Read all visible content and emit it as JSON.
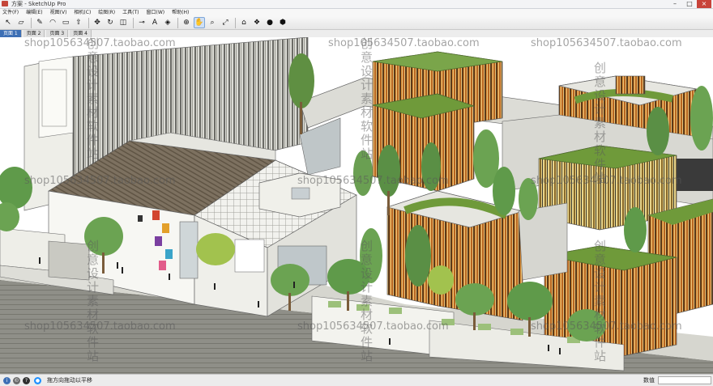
{
  "window": {
    "title": "方案 - SketchUp Pro",
    "controls": [
      "–",
      "□",
      "×"
    ]
  },
  "menu": {
    "items": [
      "文件(F)",
      "编辑(E)",
      "视图(V)",
      "相机(C)",
      "绘图(R)",
      "工具(T)",
      "窗口(W)",
      "帮助(H)"
    ]
  },
  "toolbar": {
    "tools": [
      {
        "name": "select-icon",
        "glyph": "↖"
      },
      {
        "name": "eraser-icon",
        "glyph": "▱"
      },
      {
        "name": "pencil-icon",
        "glyph": "✎"
      },
      {
        "name": "arc-icon",
        "glyph": "◠"
      },
      {
        "name": "rectangle-icon",
        "glyph": "▭"
      },
      {
        "name": "push-pull-icon",
        "glyph": "⇧"
      },
      {
        "name": "move-icon",
        "glyph": "✥"
      },
      {
        "name": "rotate-icon",
        "glyph": "↻"
      },
      {
        "name": "offset-icon",
        "glyph": "◫"
      },
      {
        "name": "tape-measure-icon",
        "glyph": "⊸"
      },
      {
        "name": "text-icon",
        "glyph": "A"
      },
      {
        "name": "paint-bucket-icon",
        "glyph": "◈"
      },
      {
        "name": "orbit-icon",
        "glyph": "⊕"
      },
      {
        "name": "pan-icon",
        "glyph": "✋"
      },
      {
        "name": "zoom-icon",
        "glyph": "⌕"
      },
      {
        "name": "zoom-extents-icon",
        "glyph": "⤢"
      },
      {
        "name": "warehouse-icon",
        "glyph": "⌂"
      },
      {
        "name": "component-icon",
        "glyph": "❖"
      },
      {
        "name": "materials-icon",
        "glyph": "●"
      },
      {
        "name": "share-icon",
        "glyph": "⬢"
      }
    ],
    "active_index": 13
  },
  "scene_tabs": [
    {
      "label": "页面 1",
      "selected": true
    },
    {
      "label": "页面 2",
      "selected": false
    },
    {
      "label": "页面 3",
      "selected": false
    },
    {
      "label": "页面 4",
      "selected": false
    }
  ],
  "watermarks": {
    "shop_url": "shop105634507.taobao.com",
    "vertical_text": "创意设计素材软件站"
  },
  "status": {
    "message": "拖方向拖动以平移",
    "measurement_label": "数值",
    "measurement_value": ""
  },
  "colors": {
    "facade_orange": "#c87a2a",
    "facade_gold": "#d8a84a",
    "green_roof": "#6f9a3a",
    "tree_green": "#5f9a4a",
    "concrete": "#e8e8e2",
    "paving": "#8a8a82",
    "accent_blue": "#3d6fb5"
  }
}
